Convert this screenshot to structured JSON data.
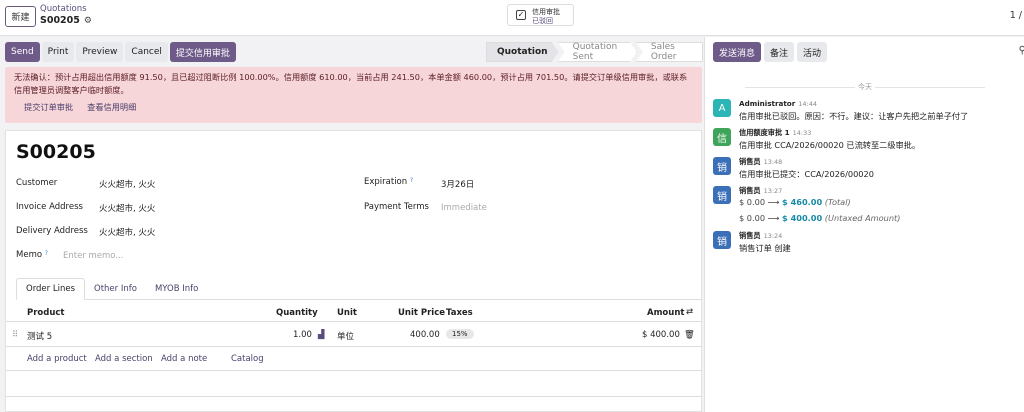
{
  "topbar": {
    "new_label": "新建",
    "breadcrumb_parent": "Quotations",
    "record_name": "S00205",
    "credit_title": "信用审批",
    "credit_status": "已驳回",
    "pager": "1 /"
  },
  "actions": {
    "send": "Send",
    "print": "Print",
    "preview": "Preview",
    "cancel": "Cancel",
    "submit_credit": "提交信用审批"
  },
  "stages": [
    "Quotation",
    "Quotation Sent",
    "Sales Order"
  ],
  "alert": {
    "text": "无法确认：预计占用超出信用额度 91.50，且已超过阻断比例 100.00%。信用额度 610.00，当前占用 241.50，本单金额 460.00，预计占用 701.50。请提交订单级信用审批，或联系信用管理员调整客户临时额度。",
    "link_submit": "提交订单审批",
    "link_view": "查看信用明细"
  },
  "form": {
    "so_number": "S00205",
    "customer_label": "Customer",
    "customer_value": "火火超市, 火火",
    "invoice_label": "Invoice Address",
    "invoice_value": "火火超市, 火火",
    "delivery_label": "Delivery Address",
    "delivery_value": "火火超市, 火火",
    "memo_label": "Memo",
    "memo_placeholder": "Enter memo...",
    "expiration_label": "Expiration",
    "expiration_value": "3月26日",
    "payment_label": "Payment Terms",
    "payment_placeholder": "Immediate",
    "help_mark": "?"
  },
  "tabs": [
    "Order Lines",
    "Other Info",
    "MYOB Info"
  ],
  "table": {
    "headers": {
      "product": "Product",
      "quantity": "Quantity",
      "unit": "Unit",
      "unit_price": "Unit Price",
      "taxes": "Taxes",
      "amount": "Amount"
    },
    "rows": [
      {
        "product": "测试 5",
        "quantity": "1.00",
        "unit": "单位",
        "unit_price": "400.00",
        "taxes": "15%",
        "amount": "$ 400.00"
      }
    ],
    "add_product": "Add a product",
    "add_section": "Add a section",
    "add_note": "Add a note",
    "catalog": "Catalog"
  },
  "chatter": {
    "send_message": "发送消息",
    "note": "备注",
    "activity": "活动",
    "today": "今天",
    "messages": [
      {
        "avatar": "A",
        "author": "Administrator",
        "time": "14:44",
        "body": "信用审批已驳回。原因：不行。建议：让客户先把之前单子付了",
        "color": "#2bb5b5"
      },
      {
        "avatar": "信",
        "author": "信用额度审批 1",
        "time": "14:33",
        "body": "信用审批 CCA/2026/00020 已流转至二级审批。",
        "color": "#3fa55b"
      },
      {
        "avatar": "销",
        "author": "销售员",
        "time": "13:48",
        "body": "信用审批已提交：CCA/2026/00020",
        "color": "#3b6fb8"
      },
      {
        "avatar": "销",
        "author": "销售员",
        "time": "13:27",
        "color": "#3b6fb8",
        "tracking": [
          {
            "old": "$ 0.00",
            "arrow": "⟶",
            "new": "$ 460.00",
            "field": "(Total)"
          },
          {
            "old": "$ 0.00",
            "arrow": "⟶",
            "new": "$ 400.00",
            "field": "(Untaxed Amount)"
          }
        ]
      },
      {
        "avatar": "销",
        "author": "销售员",
        "time": "13:24",
        "body": "销售订单 创建",
        "color": "#3b6fb8"
      }
    ]
  }
}
